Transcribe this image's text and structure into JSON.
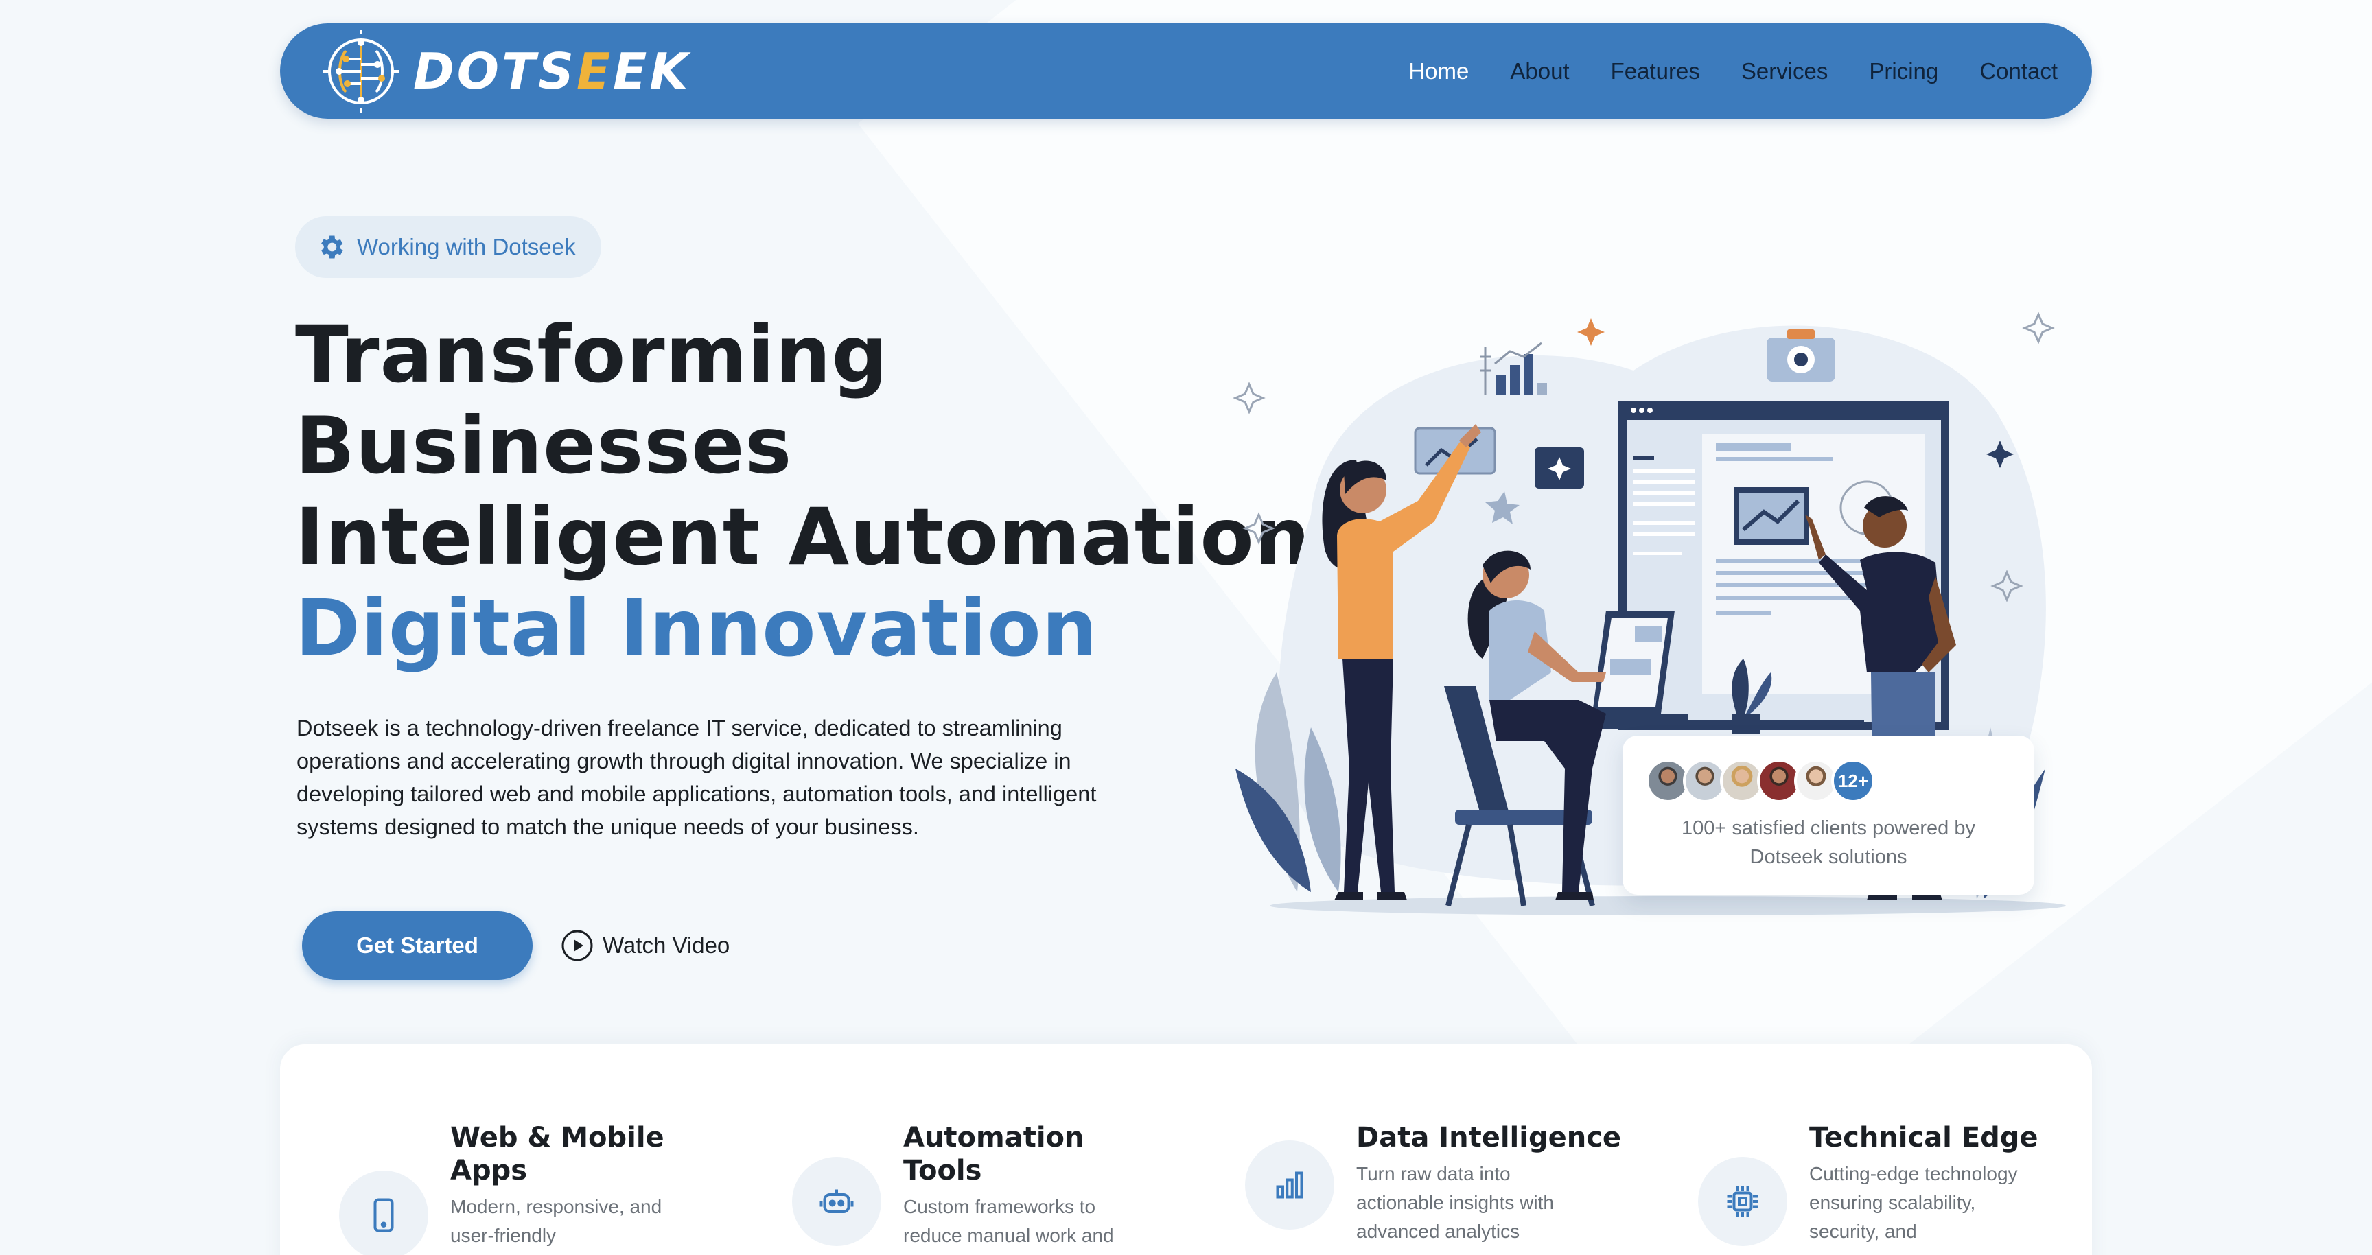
{
  "nav": {
    "brand": "DOTSEEK",
    "brand_parts": [
      "DOTS",
      "E",
      "EK"
    ],
    "links": [
      {
        "label": "Home",
        "active": true
      },
      {
        "label": "About"
      },
      {
        "label": "Features"
      },
      {
        "label": "Services"
      },
      {
        "label": "Pricing"
      },
      {
        "label": "Contact"
      }
    ]
  },
  "hero": {
    "pill": "Working with Dotseek",
    "headline": [
      "Transforming",
      "Businesses",
      "Intelligent Automation"
    ],
    "headline_accent": "Digital Innovation",
    "description": "Dotseek is a technology-driven freelance IT service, dedicated to streamlining operations and accelerating growth through digital innovation. We specialize in developing tailored web and mobile applications, automation tools, and intelligent systems designed to match the unique needs of your business.",
    "cta_primary": "Get Started",
    "cta_secondary": "Watch Video"
  },
  "clients": {
    "badge": "12+",
    "text": "100+ satisfied clients powered by Dotseek solutions"
  },
  "features": [
    {
      "title": "Web & Mobile Apps",
      "desc": "Modern, responsive, and user-friendly",
      "icon": "smartphone-icon"
    },
    {
      "title": "Automation Tools",
      "desc": "Custom frameworks to reduce manual work and",
      "icon": "robot-icon"
    },
    {
      "title": "Data Intelligence",
      "desc": "Turn raw data into actionable insights with advanced analytics",
      "icon": "bar-chart-icon"
    },
    {
      "title": "Technical Edge",
      "desc": "Cutting-edge technology ensuring scalability, security, and",
      "icon": "chip-icon"
    }
  ],
  "colors": {
    "primary": "#3c7bbd",
    "accent": "#f0b33a",
    "text": "#1b1f24",
    "muted": "#6b7178"
  }
}
